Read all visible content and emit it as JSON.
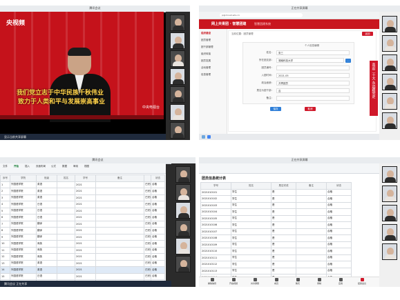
{
  "panel1": {
    "window_title": "腾讯会议",
    "logo": "央视频",
    "caption_line1": "我们党立志于中华民族千秋伟业",
    "caption_line2": "致力于人类和平与发展崇高事业",
    "watermark": "中央电视台",
    "taskbar_text": "显示当前共享屏幕"
  },
  "panel2": {
    "window_title": "正在共享屏幕",
    "url": "jxgl.hnust.edu.cn",
    "site_title": "网上共青团 · 智慧团建",
    "site_sub": "智慧团建系统",
    "nav": [
      "组织建设",
      "团员管理",
      "团干部管理",
      "组织转接",
      "团员发展",
      "活动管理",
      "信息管理"
    ],
    "breadcrumb": "当前位置：团员管理",
    "back_label": "返回",
    "form_title": "个人信息编辑",
    "fields": [
      {
        "label": "姓名：",
        "value": "张三"
      },
      {
        "label": "所在团支部：",
        "value": "湖南科技大学"
      },
      {
        "label": "团员编号：",
        "value": ""
      },
      {
        "label": "入团时间：",
        "value": "2021-05"
      },
      {
        "label": "政治面貌：",
        "value": "共青团员"
      },
      {
        "label": "是否为团干部：",
        "value": "否"
      },
      {
        "label": "备注：",
        "value": ""
      }
    ],
    "save_label": "保存",
    "cancel_label": "取消",
    "ad_text": "喜迎二十大 永远跟党走"
  },
  "panel3": {
    "window_title": "腾讯会议",
    "tabs": [
      "文件",
      "开始",
      "插入",
      "页面布局",
      "公式",
      "数据",
      "审阅",
      "视图"
    ],
    "active_tab": "开始",
    "headers": [
      "序号",
      "学院",
      "班级",
      "姓名",
      "学号",
      "备注",
      "",
      "状态"
    ],
    "rows": [
      [
        "1",
        "外国语学院",
        "英语",
        "2021",
        "已完成",
        "合格"
      ],
      [
        "2",
        "外国语学院",
        "英语",
        "2021",
        "已完成",
        "合格"
      ],
      [
        "3",
        "外国语学院",
        "英语",
        "2021",
        "已完成",
        "合格"
      ],
      [
        "4",
        "外国语学院",
        "日语",
        "2021",
        "已完成",
        "合格"
      ],
      [
        "5",
        "外国语学院",
        "日语",
        "2021",
        "已完成",
        "合格"
      ],
      [
        "6",
        "外国语学院",
        "日语",
        "2021",
        "已完成",
        "合格"
      ],
      [
        "7",
        "外国语学院",
        "翻译",
        "2021",
        "已完成",
        "合格"
      ],
      [
        "8",
        "外国语学院",
        "翻译",
        "2021",
        "已完成",
        "合格"
      ],
      [
        "9",
        "外国语学院",
        "翻译",
        "2021",
        "已完成",
        "合格"
      ],
      [
        "10",
        "外国语学院",
        "商英",
        "2021",
        "已完成",
        "合格"
      ],
      [
        "11",
        "外国语学院",
        "商英",
        "2021",
        "已完成",
        "合格"
      ],
      [
        "12",
        "外国语学院",
        "商英",
        "2021",
        "已完成",
        "合格"
      ],
      [
        "13",
        "外国语学院",
        "英语",
        "2021",
        "已完成",
        "合格"
      ],
      [
        "14",
        "外国语学院",
        "英语",
        "2021",
        "已完成",
        "合格"
      ],
      [
        "15",
        "外国语学院",
        "日语",
        "2021",
        "已完成",
        "合格"
      ],
      [
        "16",
        "外国语学院",
        "日语",
        "2021",
        "已完成",
        "合格"
      ]
    ],
    "taskbar_text": "腾讯会议 正在共享"
  },
  "panel4": {
    "window_title": "正在共享屏幕",
    "sheet_title": "团员信息统计表",
    "headers": [
      "学号",
      "姓名",
      "是否完成",
      "备注",
      "状态"
    ],
    "rows": [
      [
        "2021010101",
        "学生",
        "是",
        "",
        "合格"
      ],
      [
        "2021010102",
        "学生",
        "是",
        "",
        "合格"
      ],
      [
        "2021010103",
        "学生",
        "是",
        "",
        "合格"
      ],
      [
        "2021010104",
        "学生",
        "是",
        "",
        "合格"
      ],
      [
        "2021010105",
        "学生",
        "是",
        "",
        "合格"
      ],
      [
        "2021010106",
        "学生",
        "是",
        "",
        "合格"
      ],
      [
        "2021010107",
        "学生",
        "是",
        "",
        "合格"
      ],
      [
        "2021010108",
        "学生",
        "是",
        "",
        "合格"
      ],
      [
        "2021010109",
        "学生",
        "是",
        "",
        "合格"
      ],
      [
        "2021010110",
        "学生",
        "是",
        "",
        "合格"
      ],
      [
        "2021010111",
        "学生",
        "是",
        "",
        "合格"
      ],
      [
        "2021010112",
        "学生",
        "是",
        "",
        "合格"
      ],
      [
        "2021010113",
        "学生",
        "是",
        "",
        "合格"
      ],
      [
        "2021010114",
        "学生",
        "是",
        "",
        "合格"
      ],
      [
        "2021010115",
        "学生",
        "是",
        "",
        "合格"
      ],
      [
        "2021010116",
        "学生",
        "是",
        "",
        "合格"
      ]
    ],
    "meeting_controls": [
      "解除静音",
      "开启视频",
      "共享屏幕",
      "成员",
      "聊天",
      "录制",
      "应用",
      "结束会议"
    ]
  },
  "colors": {
    "party_red": "#c5121b",
    "accent_green": "#1a7f37",
    "accent_blue": "#2f7fd8"
  }
}
